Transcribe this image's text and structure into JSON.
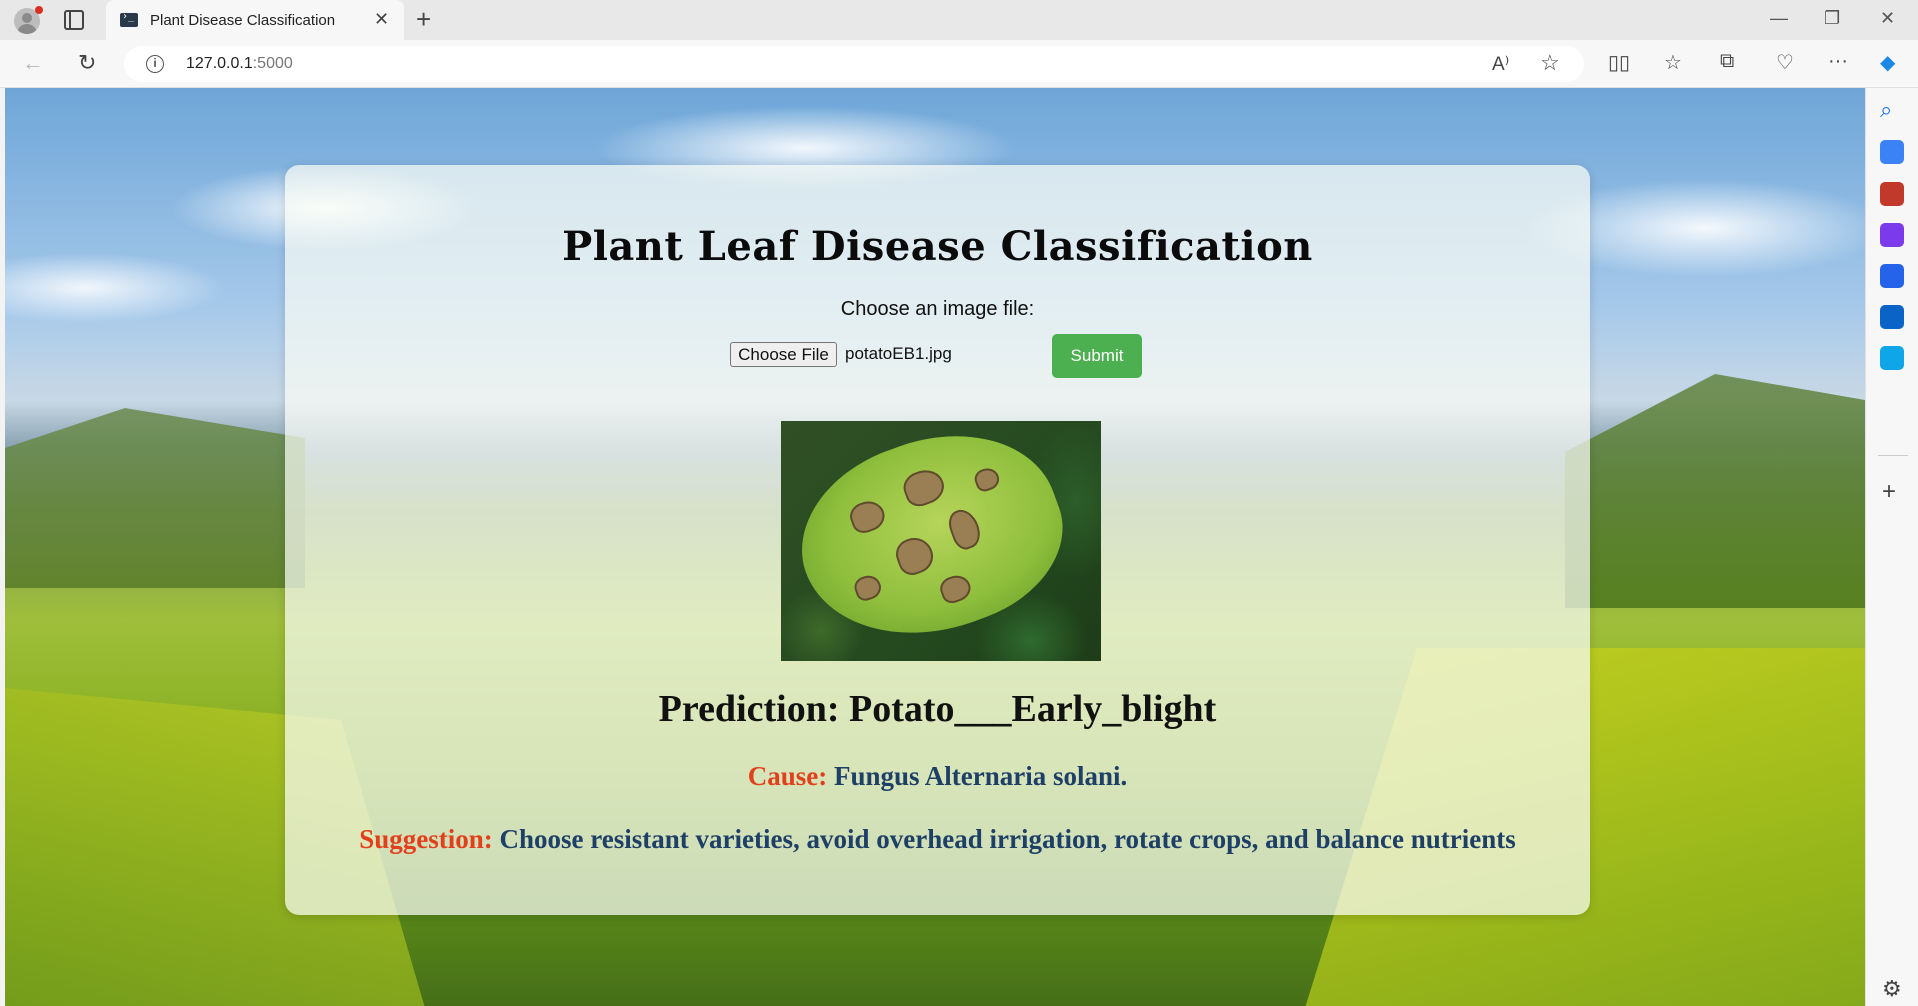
{
  "browser": {
    "tab_title": "Plant Disease Classification",
    "close_glyph": "✕",
    "new_tab_glyph": "+",
    "url_host": "127.0.0.1",
    "url_port": ":5000",
    "info_glyph": "i",
    "read_aloud_glyph": "A⁾",
    "favorite_glyph": "☆",
    "minimize_glyph": "—",
    "restore_glyph": "❐",
    "window_close_glyph": "✕",
    "back_glyph": "←",
    "refresh_glyph": "↻",
    "split_glyph": "▯▯",
    "favorites_glyph": "☆",
    "collections_glyph": "⧉",
    "health_glyph": "♡",
    "more_glyph": "···",
    "copilot_glyph": "◆"
  },
  "page": {
    "title": "Plant Leaf Disease Classification",
    "choose_label": "Choose an image file:",
    "file_button": "Choose File",
    "file_name": "potatoEB1.jpg",
    "submit_label": "Submit",
    "prediction_label": "Prediction:",
    "prediction_value": "Potato___Early_blight",
    "cause_label": "Cause:",
    "cause_value": "Fungus Alternaria solani.",
    "suggestion_label": "Suggestion:",
    "suggestion_value": "Choose resistant varieties, avoid overhead irrigation, rotate crops, and balance nutrients"
  },
  "sidebar": {
    "plus_glyph": "+",
    "gear_glyph": "⚙",
    "search_glyph": "⌕",
    "icons": [
      {
        "name": "search-icon",
        "color": "#1a73e8"
      },
      {
        "name": "shopping-tag-icon",
        "color": "#3b82f6"
      },
      {
        "name": "tools-icon",
        "color": "#c0392b"
      },
      {
        "name": "games-icon",
        "color": "#7c3aed"
      },
      {
        "name": "microsoft-365-icon",
        "color": "#2563eb"
      },
      {
        "name": "outlook-icon",
        "color": "#0a64c8"
      },
      {
        "name": "send-icon",
        "color": "#0ea5e9"
      }
    ]
  }
}
